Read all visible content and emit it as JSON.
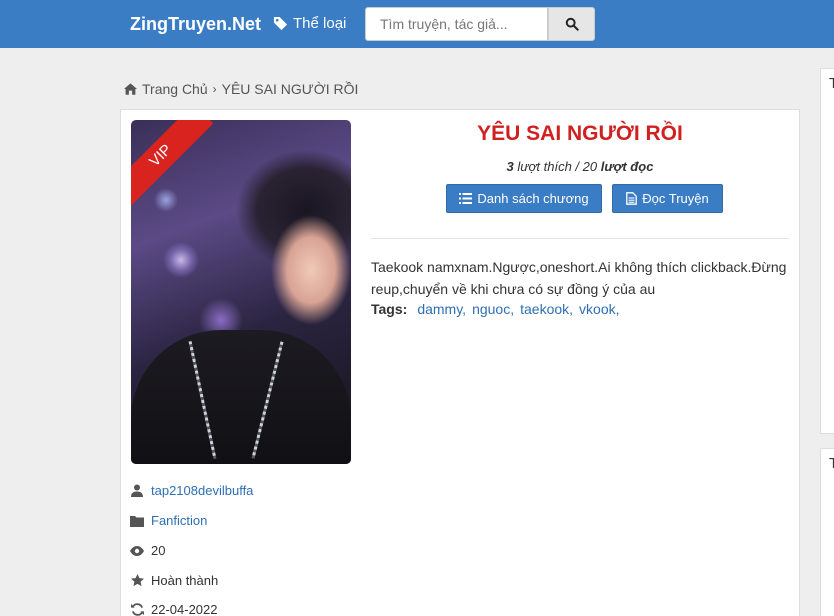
{
  "navbar": {
    "brand": "ZingTruyen.Net",
    "genre_label": "Thể loại",
    "search_placeholder": "Tìm truyện, tác giả..."
  },
  "breadcrumb": {
    "home": "Trang Chủ",
    "current": "YÊU SAI NGƯỜI RỒI"
  },
  "cover": {
    "badge": "VIP"
  },
  "story": {
    "title": "YÊU SAI NGƯỜI RỒI",
    "likes": "3",
    "likes_label": "lượt thích /",
    "reads": "20",
    "reads_label": "lượt đọc",
    "btn_chapters": "Danh sách chương",
    "btn_read": "Đọc Truyện",
    "description": "Taekook namxnam.Ngược,oneshort.Ai không thích clickback.Đừng reup,chuyển về khi chưa có sự đồng ý của au",
    "tags_label": "Tags:",
    "tags": [
      "dammy,",
      "nguoc,",
      "taekook,",
      "vkook,"
    ]
  },
  "meta": {
    "author": "tap2108devilbuffa",
    "category": "Fanfiction",
    "views": "20",
    "status": "Hoàn thành",
    "updated": "22-04-2022"
  },
  "sidebar": {
    "card1_initial": "T",
    "card2_initial": "T"
  },
  "colors": {
    "primary": "#3b7dc4",
    "title": "#d12020",
    "link": "#2d6fb4",
    "vip": "#d9231e"
  }
}
